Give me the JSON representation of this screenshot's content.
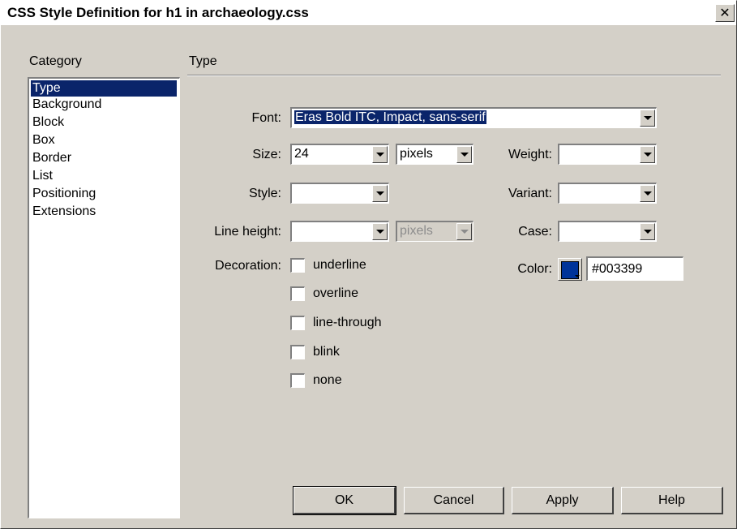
{
  "window": {
    "title": "CSS Style Definition for h1 in archaeology.css",
    "close_glyph": "✕"
  },
  "category": {
    "label": "Category",
    "items": [
      "Type",
      "Background",
      "Block",
      "Box",
      "Border",
      "List",
      "Positioning",
      "Extensions"
    ],
    "selected": "Type"
  },
  "panel": {
    "heading": "Type"
  },
  "fields": {
    "font": {
      "label": "Font:",
      "value": "Eras Bold ITC, Impact, sans-serif"
    },
    "size": {
      "label": "Size:",
      "value": "24",
      "unit": "pixels"
    },
    "weight": {
      "label": "Weight:",
      "value": ""
    },
    "style": {
      "label": "Style:",
      "value": ""
    },
    "variant": {
      "label": "Variant:",
      "value": ""
    },
    "line_height": {
      "label": "Line height:",
      "value": "",
      "unit": "pixels"
    },
    "case": {
      "label": "Case:",
      "value": ""
    },
    "decoration": {
      "label": "Decoration:",
      "options": [
        "underline",
        "overline",
        "line-through",
        "blink",
        "none"
      ]
    },
    "color": {
      "label": "Color:",
      "value": "#003399"
    }
  },
  "buttons": {
    "ok": "OK",
    "cancel": "Cancel",
    "apply": "Apply",
    "help": "Help"
  }
}
